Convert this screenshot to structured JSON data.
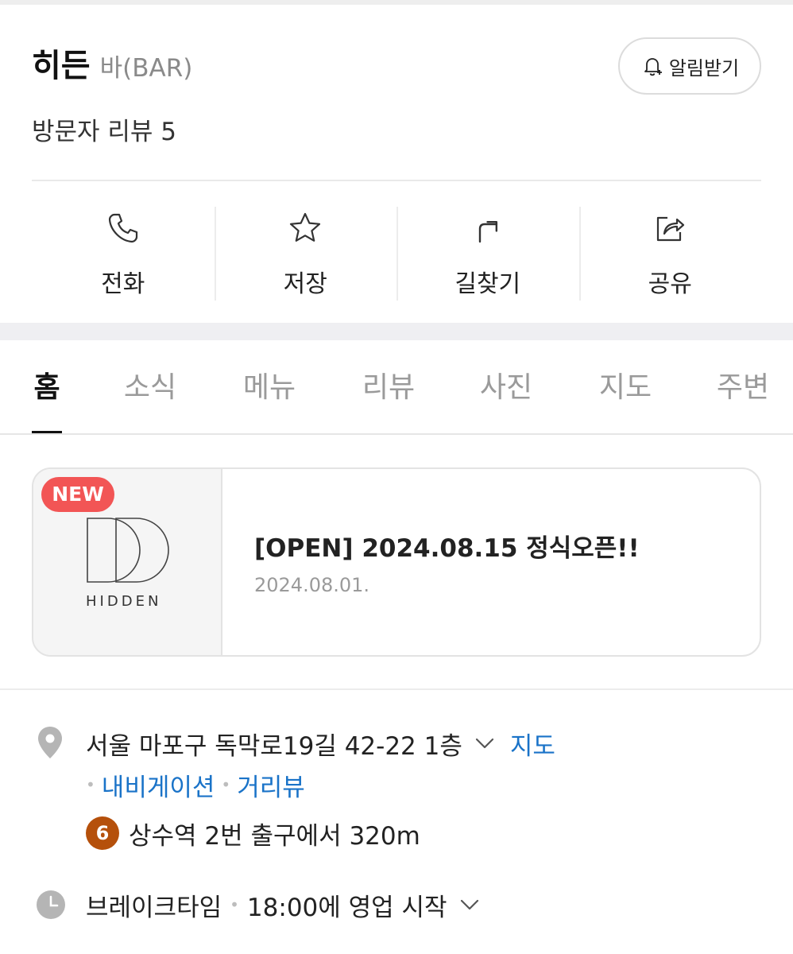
{
  "header": {
    "name": "히든",
    "category": "바(BAR)",
    "alarm_label": "알림받기",
    "review_label": "방문자 리뷰 5"
  },
  "actions": [
    {
      "label": "전화",
      "icon": "phone-icon"
    },
    {
      "label": "저장",
      "icon": "star-icon"
    },
    {
      "label": "길찾기",
      "icon": "directions-icon"
    },
    {
      "label": "공유",
      "icon": "share-icon"
    }
  ],
  "tabs": [
    {
      "label": "홈",
      "active": true
    },
    {
      "label": "소식",
      "active": false
    },
    {
      "label": "메뉴",
      "active": false
    },
    {
      "label": "리뷰",
      "active": false
    },
    {
      "label": "사진",
      "active": false
    },
    {
      "label": "지도",
      "active": false
    },
    {
      "label": "주변",
      "active": false
    }
  ],
  "news": {
    "badge": "NEW",
    "logo_text": "HIDDEN",
    "title": "[OPEN] 2024.08.15 정식오픈!!",
    "date": "2024.08.01."
  },
  "info": {
    "address": "서울 마포구 독막로19길 42-22 1층",
    "map_link": "지도",
    "links": [
      "내비게이션",
      "거리뷰"
    ],
    "subway_line": "6",
    "subway_color": "#b5500b",
    "subway_text": "상수역 2번 출구에서 320m",
    "hours_status": "브레이크타임",
    "hours_text": "18:00에 영업 시작"
  },
  "colors": {
    "link": "#1a73c8",
    "badge": "#f25555"
  }
}
